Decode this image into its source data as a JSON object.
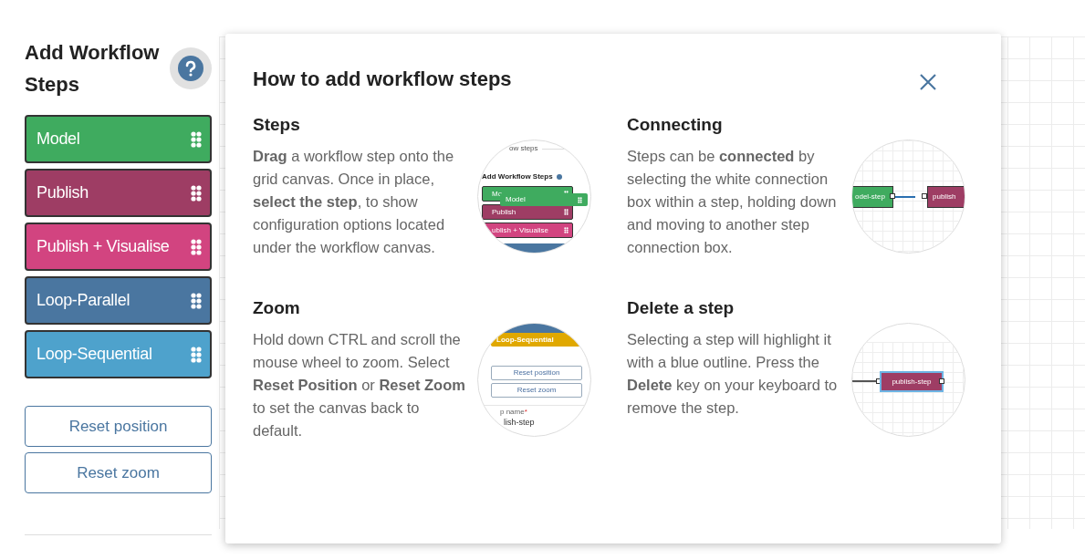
{
  "sidebar": {
    "title": "Add Workflow Steps",
    "steps": [
      {
        "label": "Model",
        "color": "#3fab5f"
      },
      {
        "label": "Publish",
        "color": "#9e3d64"
      },
      {
        "label": "Publish + Visualise",
        "color": "#d24480"
      },
      {
        "label": "Loop-Parallel",
        "color": "#4a76a0"
      },
      {
        "label": "Loop-Sequential",
        "color": "#4ea2cc"
      }
    ],
    "buttons": [
      "Reset position",
      "Reset zoom"
    ]
  },
  "dialog": {
    "title": "How to add workflow steps",
    "sections": [
      {
        "heading": "Steps",
        "text": "**Drag** a workflow step onto the grid canvas. Once in place, **select the step**, to show configuration options located under the workflow canvas.",
        "illustration": {
          "kind": "palette",
          "caption": "ow steps",
          "title": "Add Workflow Steps",
          "steps": [
            {
              "label": "Mo",
              "color": "#3fab5f"
            },
            {
              "label": "Publish",
              "color": "#9e3d64"
            },
            {
              "label": "ublish + Visualise",
              "color": "#d24480"
            }
          ],
          "dragged": {
            "label": "Model",
            "color": "#3fab5f"
          }
        }
      },
      {
        "heading": "Connecting",
        "text": "Steps can be **connected** by selecting the white connection box within a step, holding down and moving to another step connection box.",
        "illustration": {
          "kind": "connection",
          "nodes": [
            {
              "label": "odel-step",
              "color": "#3fab5f"
            },
            {
              "label": "publish",
              "color": "#9e3d64"
            }
          ]
        }
      },
      {
        "heading": "Zoom",
        "text": "Hold down CTRL and scroll the mouse wheel to zoom. Select **Reset Position** or **Reset Zoom** to set the canvas back to default.",
        "illustration": {
          "kind": "buttons",
          "step": {
            "label": "Loop-Sequential",
            "color": "#e0a800"
          },
          "buttons": [
            "Reset position",
            "Reset zoom"
          ],
          "field_label": "p name",
          "required_mark": "*",
          "field_value": "lish-step"
        }
      },
      {
        "heading": "Delete a step",
        "text": "Selecting a step will highlight it with a blue outline. Press the **Delete** key on your keyboard to remove the step.",
        "illustration": {
          "kind": "selected_node",
          "node": {
            "label": "publish-step",
            "color": "#9e3d64",
            "selected": true
          }
        }
      }
    ]
  }
}
